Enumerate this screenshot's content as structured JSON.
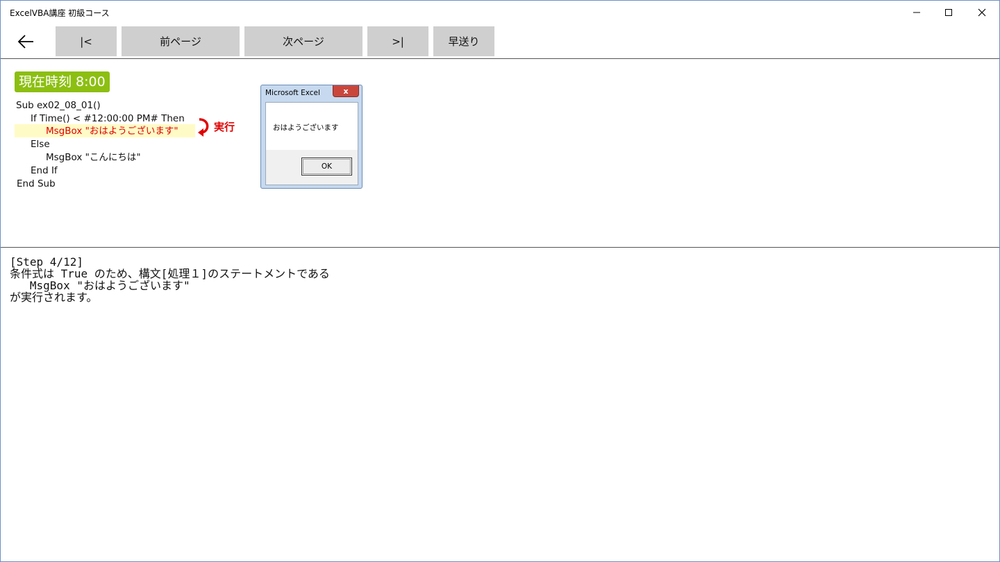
{
  "window": {
    "title": "ExcelVBA講座 初級コース",
    "controls": {
      "minimize": "—",
      "maximize": "☐",
      "close": "✕"
    }
  },
  "toolbar": {
    "back_icon": "arrow-left-icon",
    "first_label": "|<",
    "prev_label": "前ページ",
    "next_label": "次ページ",
    "last_label": ">|",
    "fast_forward_label": "早送り"
  },
  "slide": {
    "clock_label": "現在時刻 8:00",
    "code_lines": [
      "Sub ex02_08_01()",
      "If Time() < #12:00:00 PM# Then",
      "MsgBox \"おはようございます\"",
      "Else",
      "MsgBox \"こんにちは\"",
      "End If",
      "End Sub"
    ],
    "highlight_line_index": 2,
    "run_label": "実行",
    "colors": {
      "clock_bg": "#8cbf12",
      "highlight_bg": "#fffbc6",
      "run_color": "#e00000"
    }
  },
  "msgbox": {
    "title": "Microsoft Excel",
    "close_glyph": "x",
    "message": "おはようございます",
    "ok_label": "OK"
  },
  "explanation": {
    "lines": [
      "[Step 4/12]",
      "条件式は True のため、構文[処理１]のステートメントである",
      "   MsgBox \"おはようございます\"",
      "が実行されます。"
    ]
  }
}
